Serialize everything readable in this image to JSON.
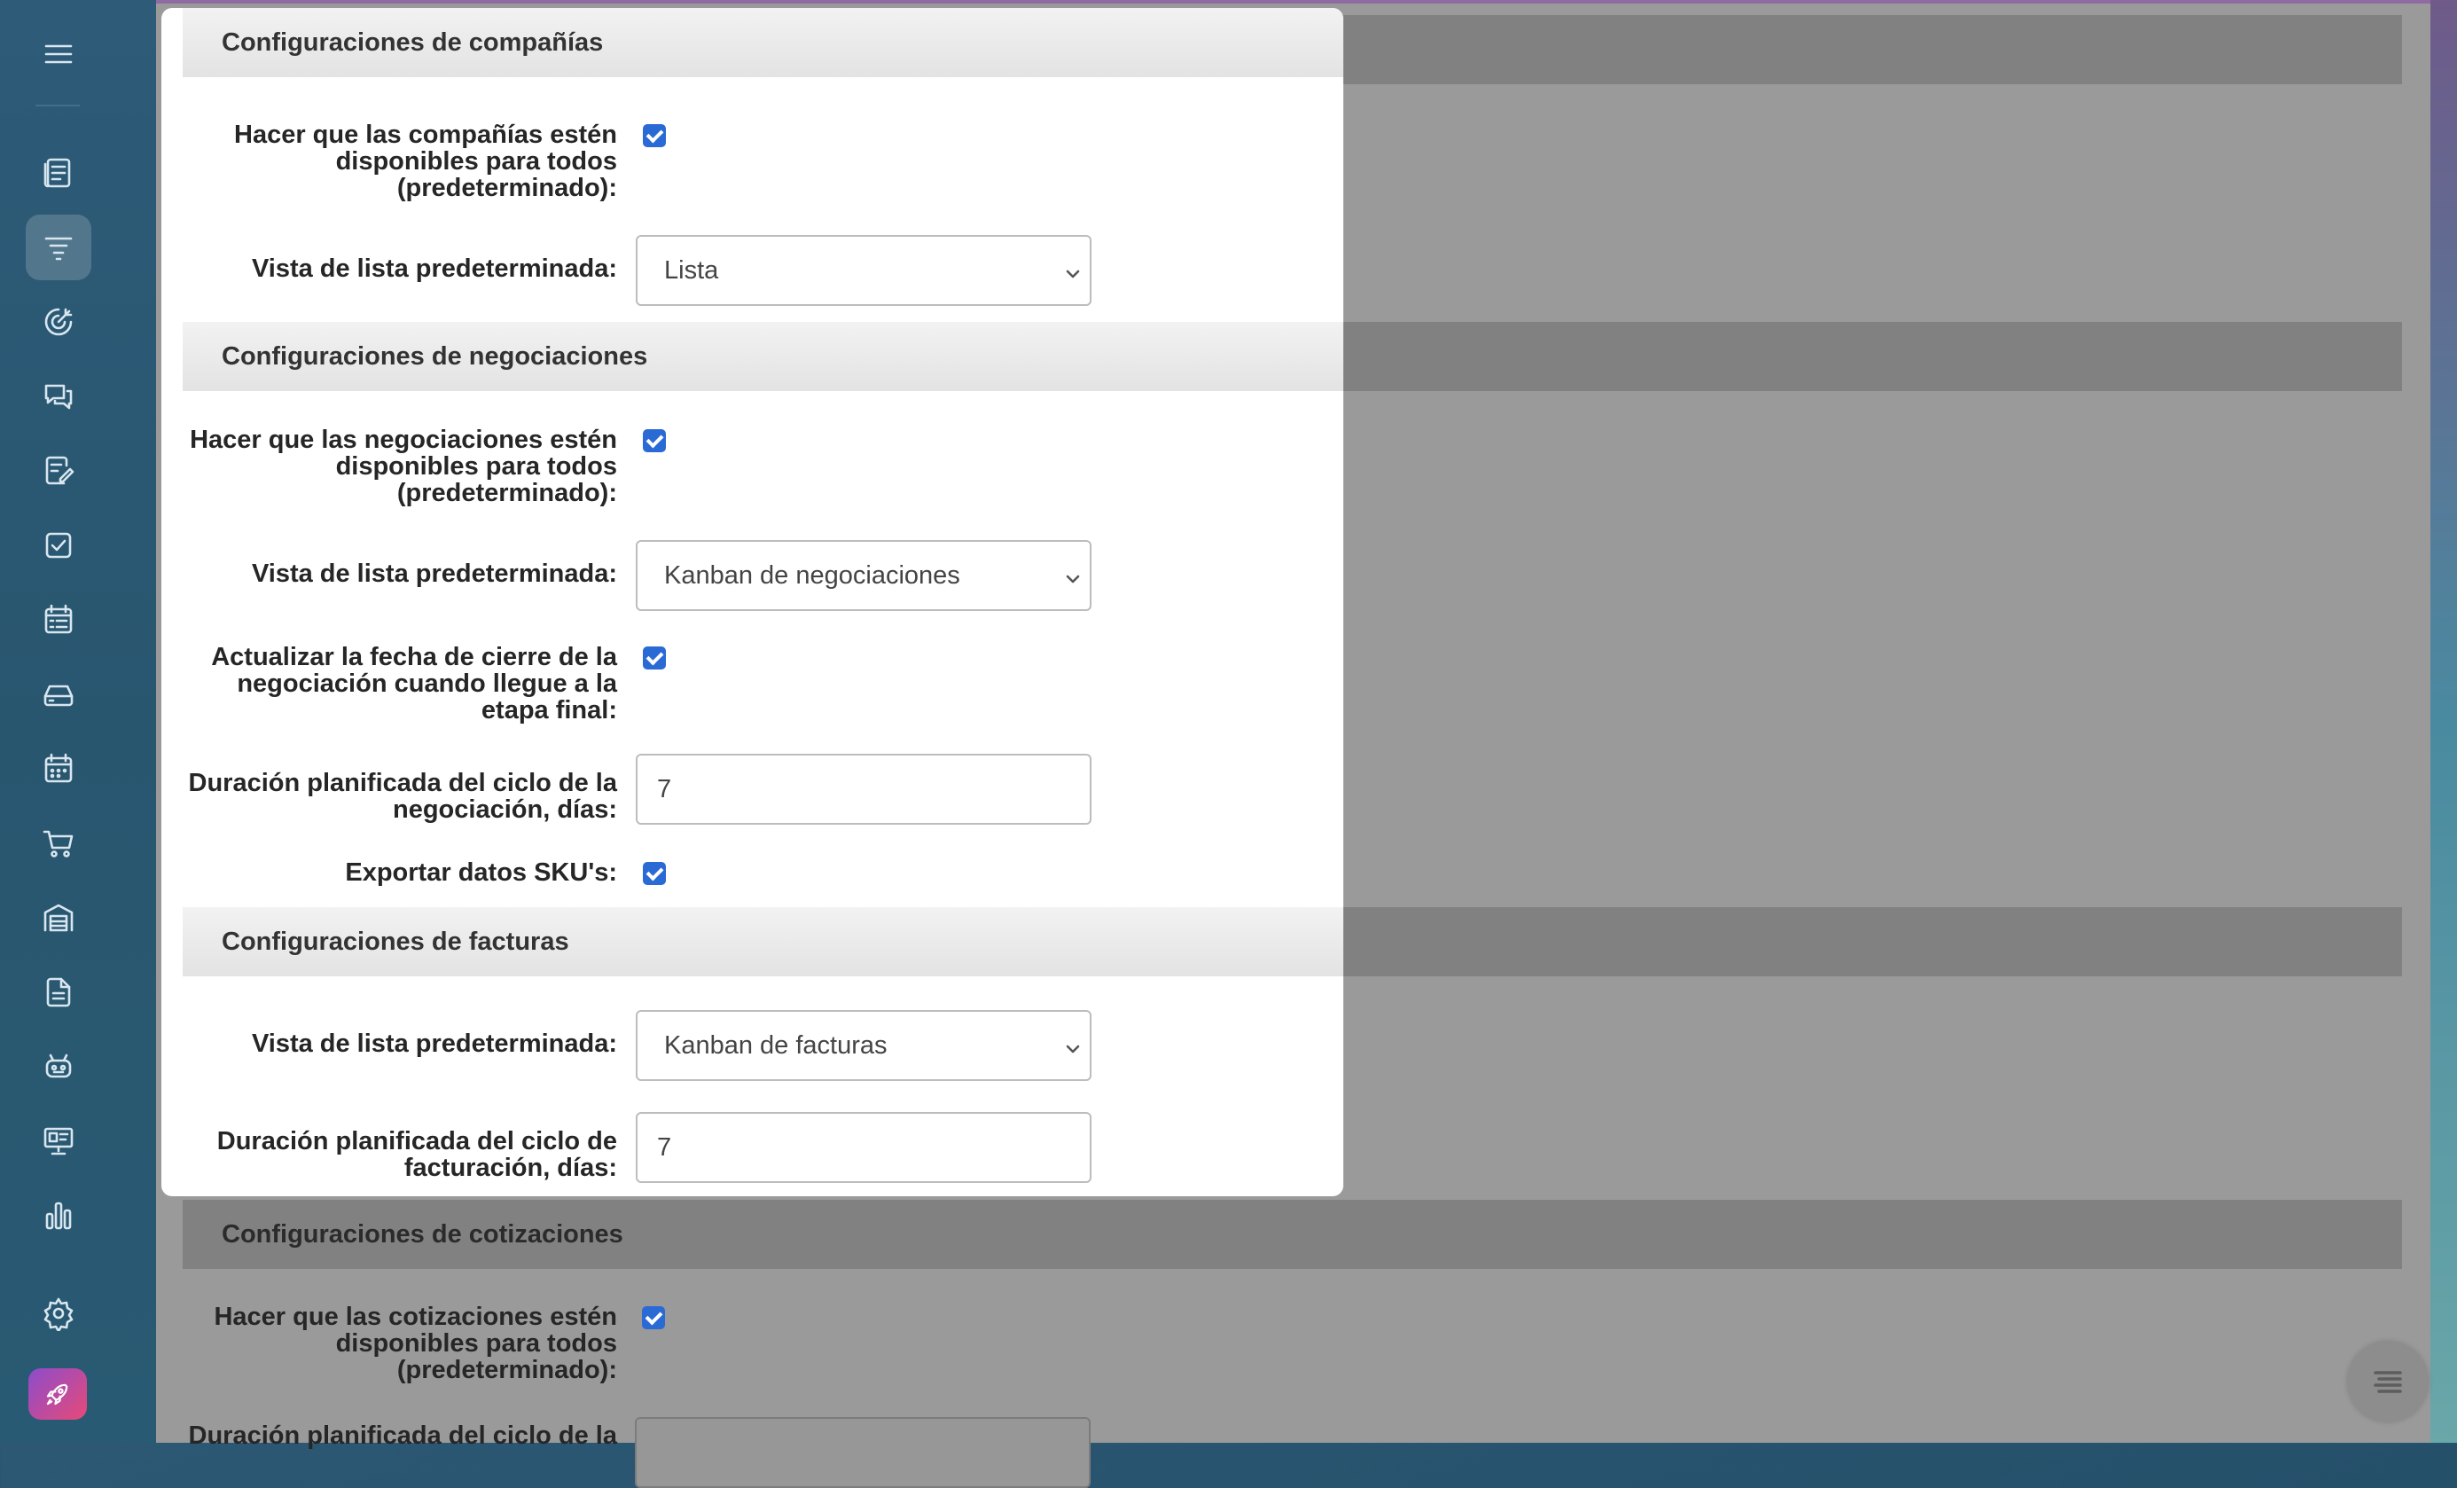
{
  "sidebar": {
    "icons": [
      "menu-icon",
      "news-feed-icon",
      "crm-funnel-icon",
      "target-icon",
      "chat-icon",
      "document-edit-icon",
      "task-check-icon",
      "calendar-list-icon",
      "drive-icon",
      "calendar-icon",
      "cart-icon",
      "warehouse-icon",
      "file-icon",
      "robot-icon",
      "presentation-icon",
      "analytics-chart-icon",
      "settings-gear-icon",
      "rocket-icon"
    ],
    "active": "crm-funnel-icon"
  },
  "panel": {
    "companies": {
      "title": "Configuraciones de compañías",
      "available_label": "Hacer que las compañías estén disponibles para todos (predeterminado):",
      "available_checked": true,
      "list_view_label": "Vista de lista predeterminada:",
      "list_view_value": "Lista"
    },
    "deals": {
      "title": "Configuraciones de negociaciones",
      "available_label": "Hacer que las negociaciones estén disponibles para todos (predeterminado):",
      "available_checked": true,
      "list_view_label": "Vista de lista predeterminada:",
      "list_view_value": "Kanban de negociaciones",
      "update_close_label": "Actualizar la fecha de cierre de la negociación cuando llegue a la etapa final:",
      "update_close_checked": true,
      "cycle_label": "Duración planificada del ciclo de la negociación, días:",
      "cycle_value": "7",
      "export_sku_label": "Exportar datos SKU's:",
      "export_sku_checked": true
    },
    "invoices": {
      "title": "Configuraciones de facturas",
      "list_view_label": "Vista de lista predeterminada:",
      "list_view_value": "Kanban de facturas",
      "cycle_label": "Duración planificada del ciclo de facturación, días:",
      "cycle_value": "7"
    }
  },
  "background": {
    "quotes": {
      "title": "Configuraciones de cotizaciones",
      "available_label": "Hacer que las cotizaciones estén disponibles para todos (predeterminado):",
      "available_checked": true,
      "cycle_label_partial": "Duración planificada del ciclo de la"
    }
  },
  "colors": {
    "accent": "#2a6ad4",
    "sidebar": "#2d5b78",
    "overlay": "#9a9a9a"
  }
}
